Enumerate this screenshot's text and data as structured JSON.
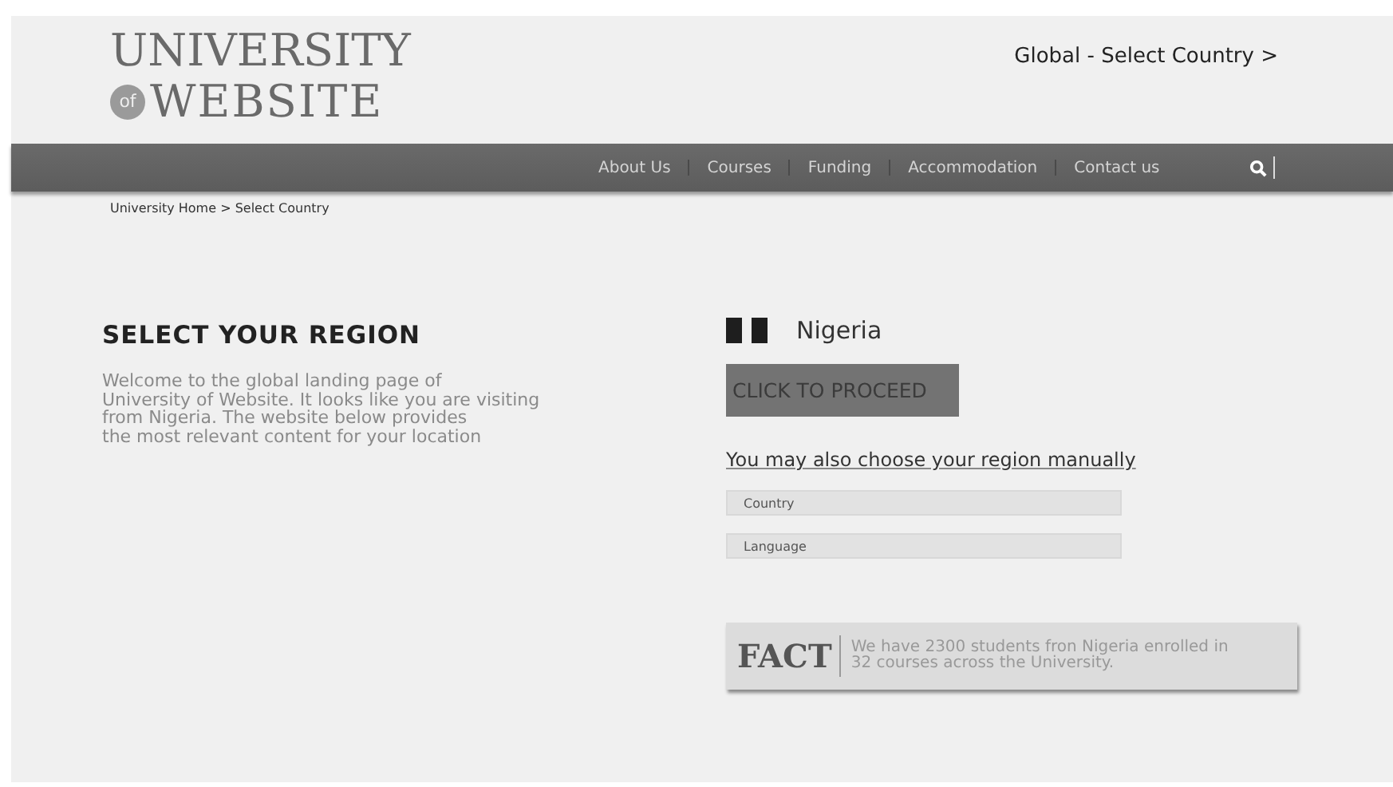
{
  "logo": {
    "line_1": "UNIVERSITY",
    "badge": "of",
    "line_2": "WEBSITE"
  },
  "header_link": "Global - Select Country >",
  "nav": {
    "items": [
      {
        "label": "About Us"
      },
      {
        "label": "Courses"
      },
      {
        "label": "Funding"
      },
      {
        "label": "Accommodation"
      },
      {
        "label": "Contact us"
      }
    ]
  },
  "breadcrumb": "University Home > Select Country",
  "intro": {
    "title": "SELECT YOUR REGION",
    "lines": [
      "Welcome to the global landing page of",
      "University of Website. It looks like you are visiting",
      "from Nigeria. The website below provides",
      "the most relevant content for your location"
    ]
  },
  "detected": {
    "country": "Nigeria",
    "button": "CLICK TO PROCEED"
  },
  "manual": {
    "link": "You may also choose your region manually",
    "fields": [
      {
        "placeholder": "Country"
      },
      {
        "placeholder": "Language"
      }
    ]
  },
  "fact": {
    "label": "FACT",
    "lines": [
      "We have 2300 students fron Nigeria enrolled in",
      "32 courses across the University."
    ]
  }
}
